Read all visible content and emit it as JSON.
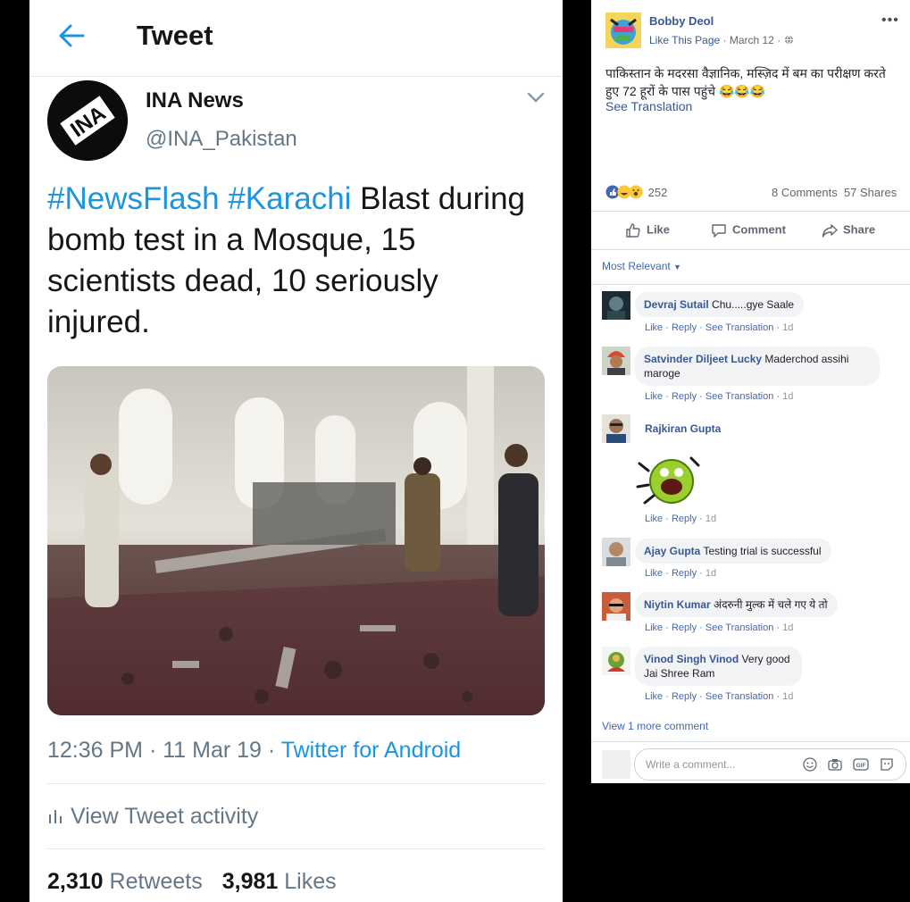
{
  "tweet": {
    "header_title": "Tweet",
    "user_name": "INA News",
    "user_handle": "@INA_Pakistan",
    "avatar_text": "INA",
    "hashtag1": "#NewsFlash",
    "hashtag2": "#Karachi",
    "text": " Blast during bomb test in a Mosque, 15 scientists dead, 10 seriously injured.",
    "time": "12:36 PM · 11 Mar 19 · ",
    "source": "Twitter for Android",
    "activity": "View Tweet activity",
    "retweets_count": "2,310",
    "retweets_label": " Retweets",
    "likes_count": "3,981",
    "likes_label": " Likes"
  },
  "facebook": {
    "page_name": "Bobby Deol",
    "like_page": "Like This Page",
    "date": " · March 12 · ",
    "post_text": "पाकिस्तान के मदरसा वैज्ञानिक, मस्ज़िद में बम का परीक्षण करते हुए 72 हूरों के पास पहुंचे 😂😂😂",
    "see_translation": "See Translation",
    "reactions_count": "252",
    "comments": "8 Comments",
    "shares": "57 Shares",
    "like_btn": "Like",
    "comment_btn": "Comment",
    "share_btn": "Share",
    "sort": "Most Relevant",
    "comment_list": [
      {
        "name": "Devraj Sutail",
        "text": " Chu.....gye Saale",
        "like": "Like",
        "reply": "Reply",
        "translate": "See Translation",
        "time": "1d"
      },
      {
        "name": "Satvinder Diljeet Lucky",
        "text": " Maderchod assihi maroge",
        "like": "Like",
        "reply": "Reply",
        "translate": "See Translation",
        "time": "1d"
      },
      {
        "name": "Rajkiran Gupta",
        "text": "",
        "like": "Like",
        "reply": "Reply",
        "time": "1d"
      },
      {
        "name": "Ajay Gupta",
        "text": " Testing trial is successful",
        "like": "Like",
        "reply": "Reply",
        "time": "1d"
      },
      {
        "name": "Niytin Kumar",
        "text": " अंदरुनी मुल्क में चले गए ये तो",
        "like": "Like",
        "reply": "Reply",
        "translate": "See Translation",
        "time": "1d"
      },
      {
        "name": "Vinod Singh Vinod",
        "text": " Very good Jai Shree Ram",
        "like": "Like",
        "reply": "Reply",
        "translate": "See Translation",
        "time": "1d"
      }
    ],
    "more_comments": "View 1 more comment",
    "write_placeholder": "Write a comment..."
  },
  "icons": [
    "back-arrow-icon",
    "chevron-down-icon",
    "bar-chart-icon",
    "globe-icon",
    "thumbs-up-icon",
    "comment-icon",
    "share-icon",
    "emoji-icon",
    "camera-icon",
    "gif-icon",
    "sticker-icon"
  ],
  "colors": {
    "twitter_blue": "#1b95e0",
    "fb_blue": "#365899",
    "fb_link": "#4267b2"
  }
}
